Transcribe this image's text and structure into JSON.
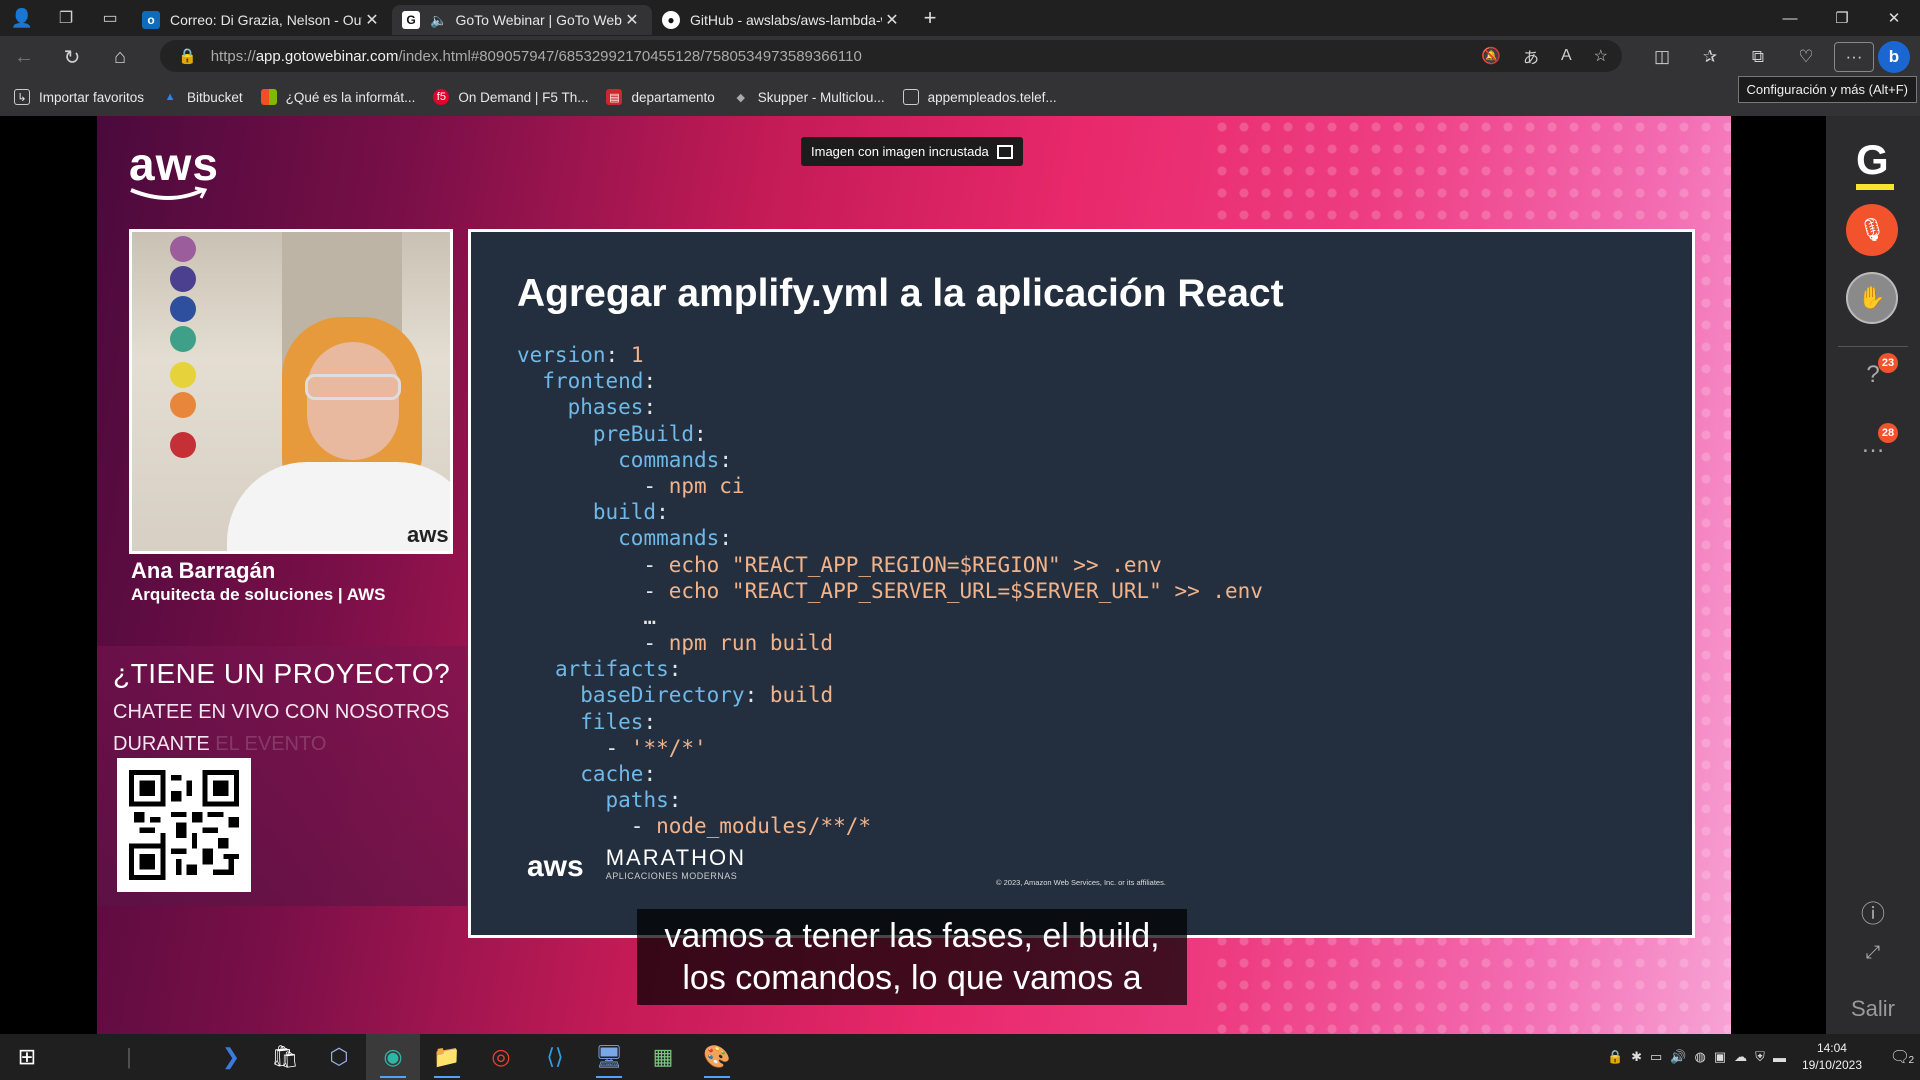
{
  "browser": {
    "tabs": [
      {
        "label": "Correo: Di Grazia, Nelson - Outlo",
        "icon": "outlook-icon",
        "active": false
      },
      {
        "label": "GoTo Webinar | GoTo Webin",
        "icon": "goto-icon",
        "active": true,
        "audio": true
      },
      {
        "label": "GitHub - awslabs/aws-lambda-w",
        "icon": "github-icon",
        "active": false
      }
    ],
    "url_prefix": "https://",
    "url_host": "app.gotowebinar.com",
    "url_path": "/index.html#809057947/6853299217045512​8/7580534973589366110",
    "tooltip": "Configuración y más (Alt+F)"
  },
  "bookmarks": [
    {
      "label": "Importar favoritos",
      "icon": "import-icon"
    },
    {
      "label": "Bitbucket",
      "icon": "bitbucket-icon"
    },
    {
      "label": "¿Qué es la informát...",
      "icon": "microsoft-icon"
    },
    {
      "label": "On Demand | F5 Th...",
      "icon": "f5-icon"
    },
    {
      "label": "departamento",
      "icon": "pdf-icon"
    },
    {
      "label": "Skupper - Multiclou...",
      "icon": "skupper-icon"
    },
    {
      "label": "appempleados.telef...",
      "icon": "page-icon"
    }
  ],
  "webinar": {
    "brand": "aws",
    "pip_label": "Imagen con imagen incrustada",
    "presenter": {
      "name": "Ana Barragán",
      "role": "Arquitecta de soluciones | AWS",
      "hoodie": "aws"
    },
    "promo": {
      "title": "¿TIENE UN PROYECTO?",
      "subtitle": "CHATEE EN VIVO CON NOSOTROS DURANTE",
      "faded": "EL EVENTO"
    },
    "slide": {
      "title": "Agregar amplify.yml a la aplicación React",
      "code": [
        [
          {
            "t": "key",
            "v": "version"
          },
          {
            "t": "punct",
            "v": ": "
          },
          {
            "t": "val",
            "v": "1"
          }
        ],
        [
          {
            "t": "punct",
            "v": "  "
          },
          {
            "t": "key",
            "v": "frontend"
          },
          {
            "t": "punct",
            "v": ":"
          }
        ],
        [
          {
            "t": "punct",
            "v": "    "
          },
          {
            "t": "key",
            "v": "phases"
          },
          {
            "t": "punct",
            "v": ":"
          }
        ],
        [
          {
            "t": "punct",
            "v": "      "
          },
          {
            "t": "key",
            "v": "preBuild"
          },
          {
            "t": "punct",
            "v": ":"
          }
        ],
        [
          {
            "t": "punct",
            "v": "        "
          },
          {
            "t": "key",
            "v": "commands"
          },
          {
            "t": "punct",
            "v": ":"
          }
        ],
        [
          {
            "t": "punct",
            "v": "          - "
          },
          {
            "t": "val",
            "v": "npm ci"
          }
        ],
        [
          {
            "t": "punct",
            "v": "      "
          },
          {
            "t": "key",
            "v": "build"
          },
          {
            "t": "punct",
            "v": ":"
          }
        ],
        [
          {
            "t": "punct",
            "v": "        "
          },
          {
            "t": "key",
            "v": "commands"
          },
          {
            "t": "punct",
            "v": ":"
          }
        ],
        [
          {
            "t": "punct",
            "v": "          - "
          },
          {
            "t": "val",
            "v": "echo \"REACT_APP_REGION=$REGION\" >> .env"
          }
        ],
        [
          {
            "t": "punct",
            "v": "          - "
          },
          {
            "t": "val",
            "v": "echo \"REACT_APP_SERVER_URL=$SERVER_URL\" >> .env"
          }
        ],
        [
          {
            "t": "punct",
            "v": "          …"
          }
        ],
        [
          {
            "t": "punct",
            "v": "          - "
          },
          {
            "t": "val",
            "v": "npm run build"
          }
        ],
        [
          {
            "t": "punct",
            "v": "   "
          },
          {
            "t": "key",
            "v": "artifacts"
          },
          {
            "t": "punct",
            "v": ":"
          }
        ],
        [
          {
            "t": "punct",
            "v": "     "
          },
          {
            "t": "key",
            "v": "baseDirectory"
          },
          {
            "t": "punct",
            "v": ": "
          },
          {
            "t": "val",
            "v": "build"
          }
        ],
        [
          {
            "t": "punct",
            "v": "     "
          },
          {
            "t": "key",
            "v": "files"
          },
          {
            "t": "punct",
            "v": ":"
          }
        ],
        [
          {
            "t": "punct",
            "v": "       - "
          },
          {
            "t": "val",
            "v": "'**/*'"
          }
        ],
        [
          {
            "t": "punct",
            "v": "     "
          },
          {
            "t": "key",
            "v": "cache"
          },
          {
            "t": "punct",
            "v": ":"
          }
        ],
        [
          {
            "t": "punct",
            "v": "       "
          },
          {
            "t": "key",
            "v": "paths"
          },
          {
            "t": "punct",
            "v": ":"
          }
        ],
        [
          {
            "t": "punct",
            "v": "         - "
          },
          {
            "t": "val",
            "v": "node_modules/**/*"
          }
        ]
      ],
      "footer_brand": "aws",
      "footer_event": "MARATHON",
      "footer_sub": "APLICACIONES MODERNAS",
      "copyright": "© 2023, Amazon Web Services, Inc. or its affiliates."
    },
    "caption": [
      "vamos a tener las fases, el build,",
      "los comandos, lo que vamos a"
    ]
  },
  "goto_panel": {
    "questions_count": "23",
    "chat_count": "28",
    "exit_label": "Salir"
  },
  "taskbar": {
    "time": "14:04",
    "date": "19/10/2023",
    "notifications": "2"
  }
}
